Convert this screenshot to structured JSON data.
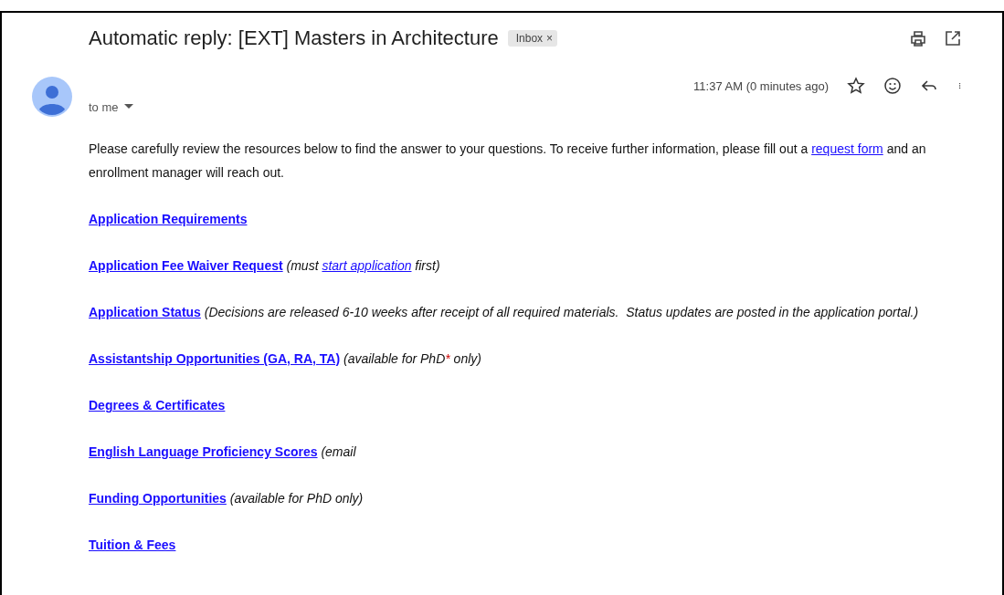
{
  "subject": "Automatic reply: [EXT] Masters in Architecture",
  "label": {
    "text": "Inbox",
    "remove": "×"
  },
  "recipient": "to me",
  "time": "11:37 AM (0 minutes ago)",
  "intro": [
    {
      "kind": "plain",
      "text": "Please carefully review the resources below to find the answer to your questions. To receive further information, please fill out a "
    },
    {
      "kind": "link",
      "text": "request form"
    },
    {
      "kind": "plain",
      "text": " and an enrollment manager will reach out."
    }
  ],
  "resources": [
    {
      "link": "Application Requirements"
    },
    {
      "link": "Application Fee Waiver Request",
      "note": [
        {
          "kind": "plain",
          "text": "(must "
        },
        {
          "kind": "link",
          "text": "start application"
        },
        {
          "kind": "plain",
          "text": " first)"
        }
      ]
    },
    {
      "link": "Application Status",
      "note": [
        {
          "kind": "plain",
          "text": "(Decisions are released 6-10 weeks after receipt of all required materials.  Status updates are posted in the application portal.)"
        }
      ]
    },
    {
      "link": "Assistantship Opportunities (GA, RA, TA)",
      "note": [
        {
          "kind": "plain",
          "text": "(available for PhD"
        },
        {
          "kind": "mark",
          "text": "*"
        },
        {
          "kind": "plain",
          "text": " only)"
        }
      ]
    },
    {
      "link": "Degrees & Certificates"
    },
    {
      "link": "English Language Proficiency Scores",
      "note": [
        {
          "kind": "plain",
          "text": "(email"
        }
      ]
    },
    {
      "link": "Funding Opportunities",
      "note": [
        {
          "kind": "plain",
          "text": "(available for PhD only)"
        }
      ]
    },
    {
      "link": "Tuition & Fees"
    }
  ]
}
